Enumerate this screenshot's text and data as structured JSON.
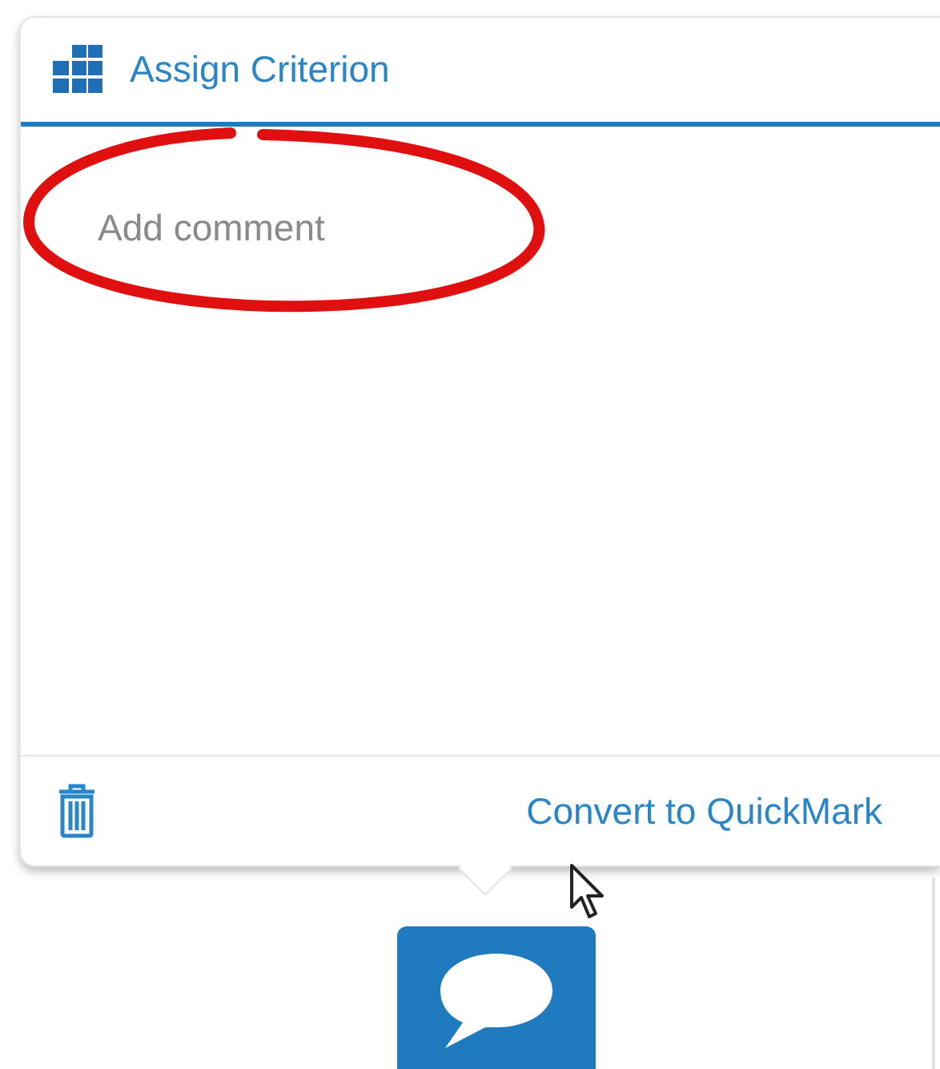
{
  "panel": {
    "title": "Assign Criterion",
    "comment": {
      "placeholder": "Add comment"
    },
    "footer": {
      "convert_link": "Convert to QuickMark"
    }
  }
}
